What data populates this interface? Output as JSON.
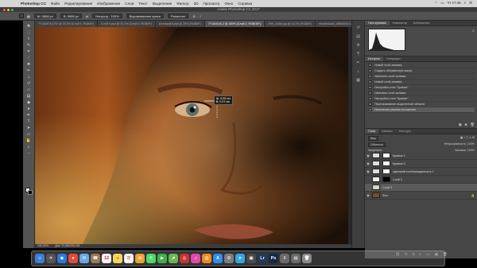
{
  "menubar": {
    "app_name": "Photoshop CC",
    "items": [
      "Файл",
      "Редактирование",
      "Изображение",
      "Слои",
      "Текст",
      "Выделение",
      "Фильтр",
      "3D",
      "Просмотр",
      "Окно",
      "Справка"
    ],
    "time": "Чт 17:45"
  },
  "window": {
    "title": "Adobe Photoshop CC 2017"
  },
  "options": {
    "w_label": "Ш: 3888 px",
    "h_label": "В: 3888 px",
    "opacity": "Непрозр.: 100%",
    "align": "Выравнивание краев",
    "mode_label": "Размытие"
  },
  "tabs": [
    {
      "label": "7Y1A0678.CR2 @ 33,3% (Слой 1, RGB/8*)",
      "active": false
    },
    {
      "label": "Слой 0.psd @ 33,3% (Слой 0, RGB/8*)",
      "active": false
    },
    {
      "label": "коллаж@6.psd @ 25% (RGB/8*)",
      "active": false
    },
    {
      "label": "7Y1A0144-2 @ 100% (Слой 2, RGB/16*)",
      "active": true
    },
    {
      "label": "2991_638a.jpg @ 33,3% (RGB/8*)",
      "active": false
    },
    {
      "label": "shutterstock_288949417.jpg @ 35%",
      "active": false
    }
  ],
  "canvas": {
    "measure_w": "Ш: 0,55 см",
    "measure_h": "В: 0,07 см"
  },
  "statusbar": {
    "zoom": "100,00%",
    "doc": "Док: 72,6М/330,2М"
  },
  "panels": {
    "top_tabs": [
      "Гистограмма",
      "Навигатор",
      "Библиотеки"
    ],
    "history_tabs": [
      "История",
      "Операции"
    ],
    "history_items": [
      {
        "label": "Новый слой-заливка",
        "active": false
      },
      {
        "label": "Создать обтравочную маску",
        "active": false
      },
      {
        "label": "Изменить слой заливки",
        "active": false
      },
      {
        "label": "Новый слой-заливка",
        "active": false
      },
      {
        "label": "Настройки слоя \"Кривые\"",
        "active": false
      },
      {
        "label": "Изменить слой заливки",
        "active": false
      },
      {
        "label": "Настройка слоя \"Кривые\"",
        "active": false
      },
      {
        "label": "Перетаскивание выделенной области",
        "active": false
      },
      {
        "label": "Изменение режима наложения",
        "active": true
      }
    ],
    "layers_tabs": [
      "Слои",
      "Каналы",
      "Контуры"
    ],
    "layers_kind": "Вид",
    "blend_mode": "Обычные",
    "opacity": "Непрозрачность: 100%",
    "fill": "Заливка: 100%",
    "lock_label": "Закрепить:",
    "layers": [
      {
        "name": "Кривые 1",
        "thumb": "#ffffff",
        "visible": true,
        "active": false
      },
      {
        "name": "Кривые 2",
        "thumb": "#ffffff",
        "visible": true,
        "active": false
      },
      {
        "name": "Цветовой тон/Насыщенность 1",
        "thumb": "#ffffff",
        "visible": true,
        "active": false
      },
      {
        "name": "Слой 2",
        "thumb": "#eeeeee",
        "visible": false,
        "active": false
      },
      {
        "name": "Слой 3",
        "thumb": "#d9d2c6",
        "visible": false,
        "active": true
      },
      {
        "name": "Фон",
        "thumb": "#7a4d28",
        "visible": true,
        "active": false
      }
    ]
  },
  "dock": [
    {
      "icon": "finder-icon",
      "color": "#3b7fd6",
      "glyph": "☺"
    },
    {
      "icon": "launchpad-icon",
      "color": "#555555",
      "glyph": "✈"
    },
    {
      "icon": "safari-icon",
      "color": "#2b7bd8",
      "glyph": "◉"
    },
    {
      "icon": "chrome-icon",
      "color": "#e24a3a",
      "glyph": "●"
    },
    {
      "icon": "mail-icon",
      "color": "#6aa7e8",
      "glyph": "✉"
    },
    {
      "icon": "contacts-icon",
      "color": "#9a7a5a",
      "glyph": "☎"
    },
    {
      "icon": "calendar-icon",
      "color": "#f4f4f4",
      "glyph": "12"
    },
    {
      "icon": "notes-icon",
      "color": "#f3d75c",
      "glyph": "≡"
    },
    {
      "icon": "reminders-icon",
      "color": "#f4f4f4",
      "glyph": "☰"
    },
    {
      "icon": "photos-icon",
      "color": "#f0a030",
      "glyph": "✿"
    },
    {
      "icon": "messages-icon",
      "color": "#4cd964",
      "glyph": "✆"
    },
    {
      "icon": "facetime-icon",
      "color": "#3bb34a",
      "glyph": "▶"
    },
    {
      "icon": "maps-icon",
      "color": "#6cb556",
      "glyph": "⬈"
    },
    {
      "icon": "photo-booth-icon",
      "color": "#c8342e",
      "glyph": "◎"
    },
    {
      "icon": "itunes-icon",
      "color": "#e246a8",
      "glyph": "♫"
    },
    {
      "icon": "ibooks-icon",
      "color": "#f08a1c",
      "glyph": "▥"
    },
    {
      "icon": "app-store-icon",
      "color": "#2f8cf0",
      "glyph": "A"
    },
    {
      "icon": "system-prefs-icon",
      "color": "#7d7d7d",
      "glyph": "⚙"
    },
    {
      "icon": "telegram-icon",
      "color": "#34a8e0",
      "glyph": "➤"
    },
    {
      "icon": "finder-window-icon",
      "color": "#4a4a4a",
      "glyph": "▣"
    },
    {
      "icon": "lightroom-icon",
      "color": "#1d3a5a",
      "glyph": "Lr"
    },
    {
      "icon": "photoshop-icon",
      "color": "#0f2a4a",
      "glyph": "Ps"
    },
    {
      "icon": "downloads-icon",
      "color": "#6a6a6a",
      "glyph": "⇩"
    },
    {
      "icon": "documents-icon",
      "color": "#6a6a6a",
      "glyph": "▤"
    },
    {
      "icon": "trash-icon",
      "color": "#8a8a8a",
      "glyph": "🗑"
    }
  ],
  "colors": {
    "accent": "#1f6fd6",
    "panel_bg": "#464646",
    "workspace": "#535353"
  }
}
